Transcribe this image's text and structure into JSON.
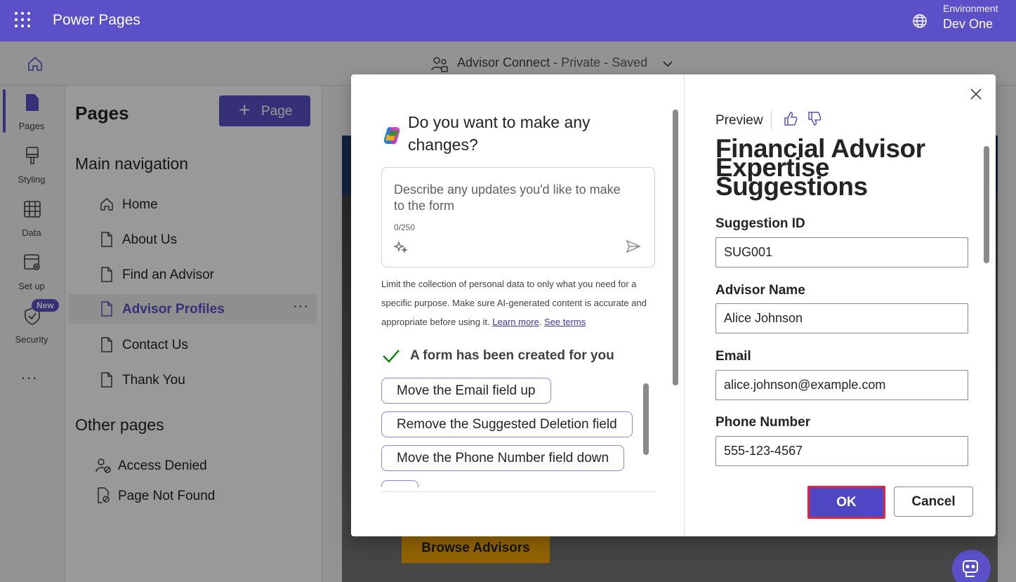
{
  "topbar": {
    "app_title": "Power Pages",
    "environment_label": "Environment",
    "environment_name": "Dev One"
  },
  "subbar": {
    "site_name": "Advisor Connect",
    "site_status": " - Private - Saved"
  },
  "rail": {
    "items": [
      {
        "label": "Pages",
        "icon": "page-icon",
        "active": true
      },
      {
        "label": "Styling",
        "icon": "brush-icon"
      },
      {
        "label": "Data",
        "icon": "table-icon"
      },
      {
        "label": "Set up",
        "icon": "settings-icon"
      },
      {
        "label": "Security",
        "icon": "shield-icon"
      }
    ],
    "new_badge": "New",
    "more": "..."
  },
  "pages_panel": {
    "title": "Pages",
    "add_button": "Page",
    "main_nav_title": "Main navigation",
    "main_nav": [
      {
        "label": "Home",
        "icon": "home-icon"
      },
      {
        "label": "About Us",
        "icon": "page-icon"
      },
      {
        "label": "Find an Advisor",
        "icon": "page-icon"
      },
      {
        "label": "Advisor Profiles",
        "icon": "page-icon",
        "active": true
      },
      {
        "label": "Contact Us",
        "icon": "page-icon"
      },
      {
        "label": "Thank You",
        "icon": "page-icon"
      }
    ],
    "other_title": "Other pages",
    "other_pages": [
      {
        "label": "Access Denied",
        "icon": "person-blocked-icon"
      },
      {
        "label": "Page Not Found",
        "icon": "page-search-icon"
      }
    ]
  },
  "canvas": {
    "browse_button": "Browse Advisors"
  },
  "dialog": {
    "question": "Do you want to make any changes?",
    "prompt_placeholder": "Describe any updates you'd like to make to the form",
    "prompt_count": "0/250",
    "disclaimer": "Limit the collection of personal data to only what you need for a specific purpose. Make sure AI-generated content is accurate and appropriate before using it.",
    "learn_more": "Learn more",
    "see_terms": "See terms",
    "created_message": "A form has been created for you",
    "suggestions": [
      "Move the Email field up",
      "Remove the Suggested Deletion field",
      "Move the Phone Number field down"
    ],
    "preview_label": "Preview",
    "form_title": "Financial Advisor Expertise Suggestions",
    "fields": [
      {
        "label": "Suggestion ID",
        "value": "SUG001"
      },
      {
        "label": "Advisor Name",
        "value": "Alice Johnson"
      },
      {
        "label": "Email",
        "value": "alice.johnson@example.com"
      },
      {
        "label": "Phone Number",
        "value": "555-123-4567"
      }
    ],
    "ok_button": "OK",
    "cancel_button": "Cancel"
  },
  "colors": {
    "brand": "#5b50c8",
    "highlight_border": "#e3243b",
    "success_check": "#107c10"
  }
}
